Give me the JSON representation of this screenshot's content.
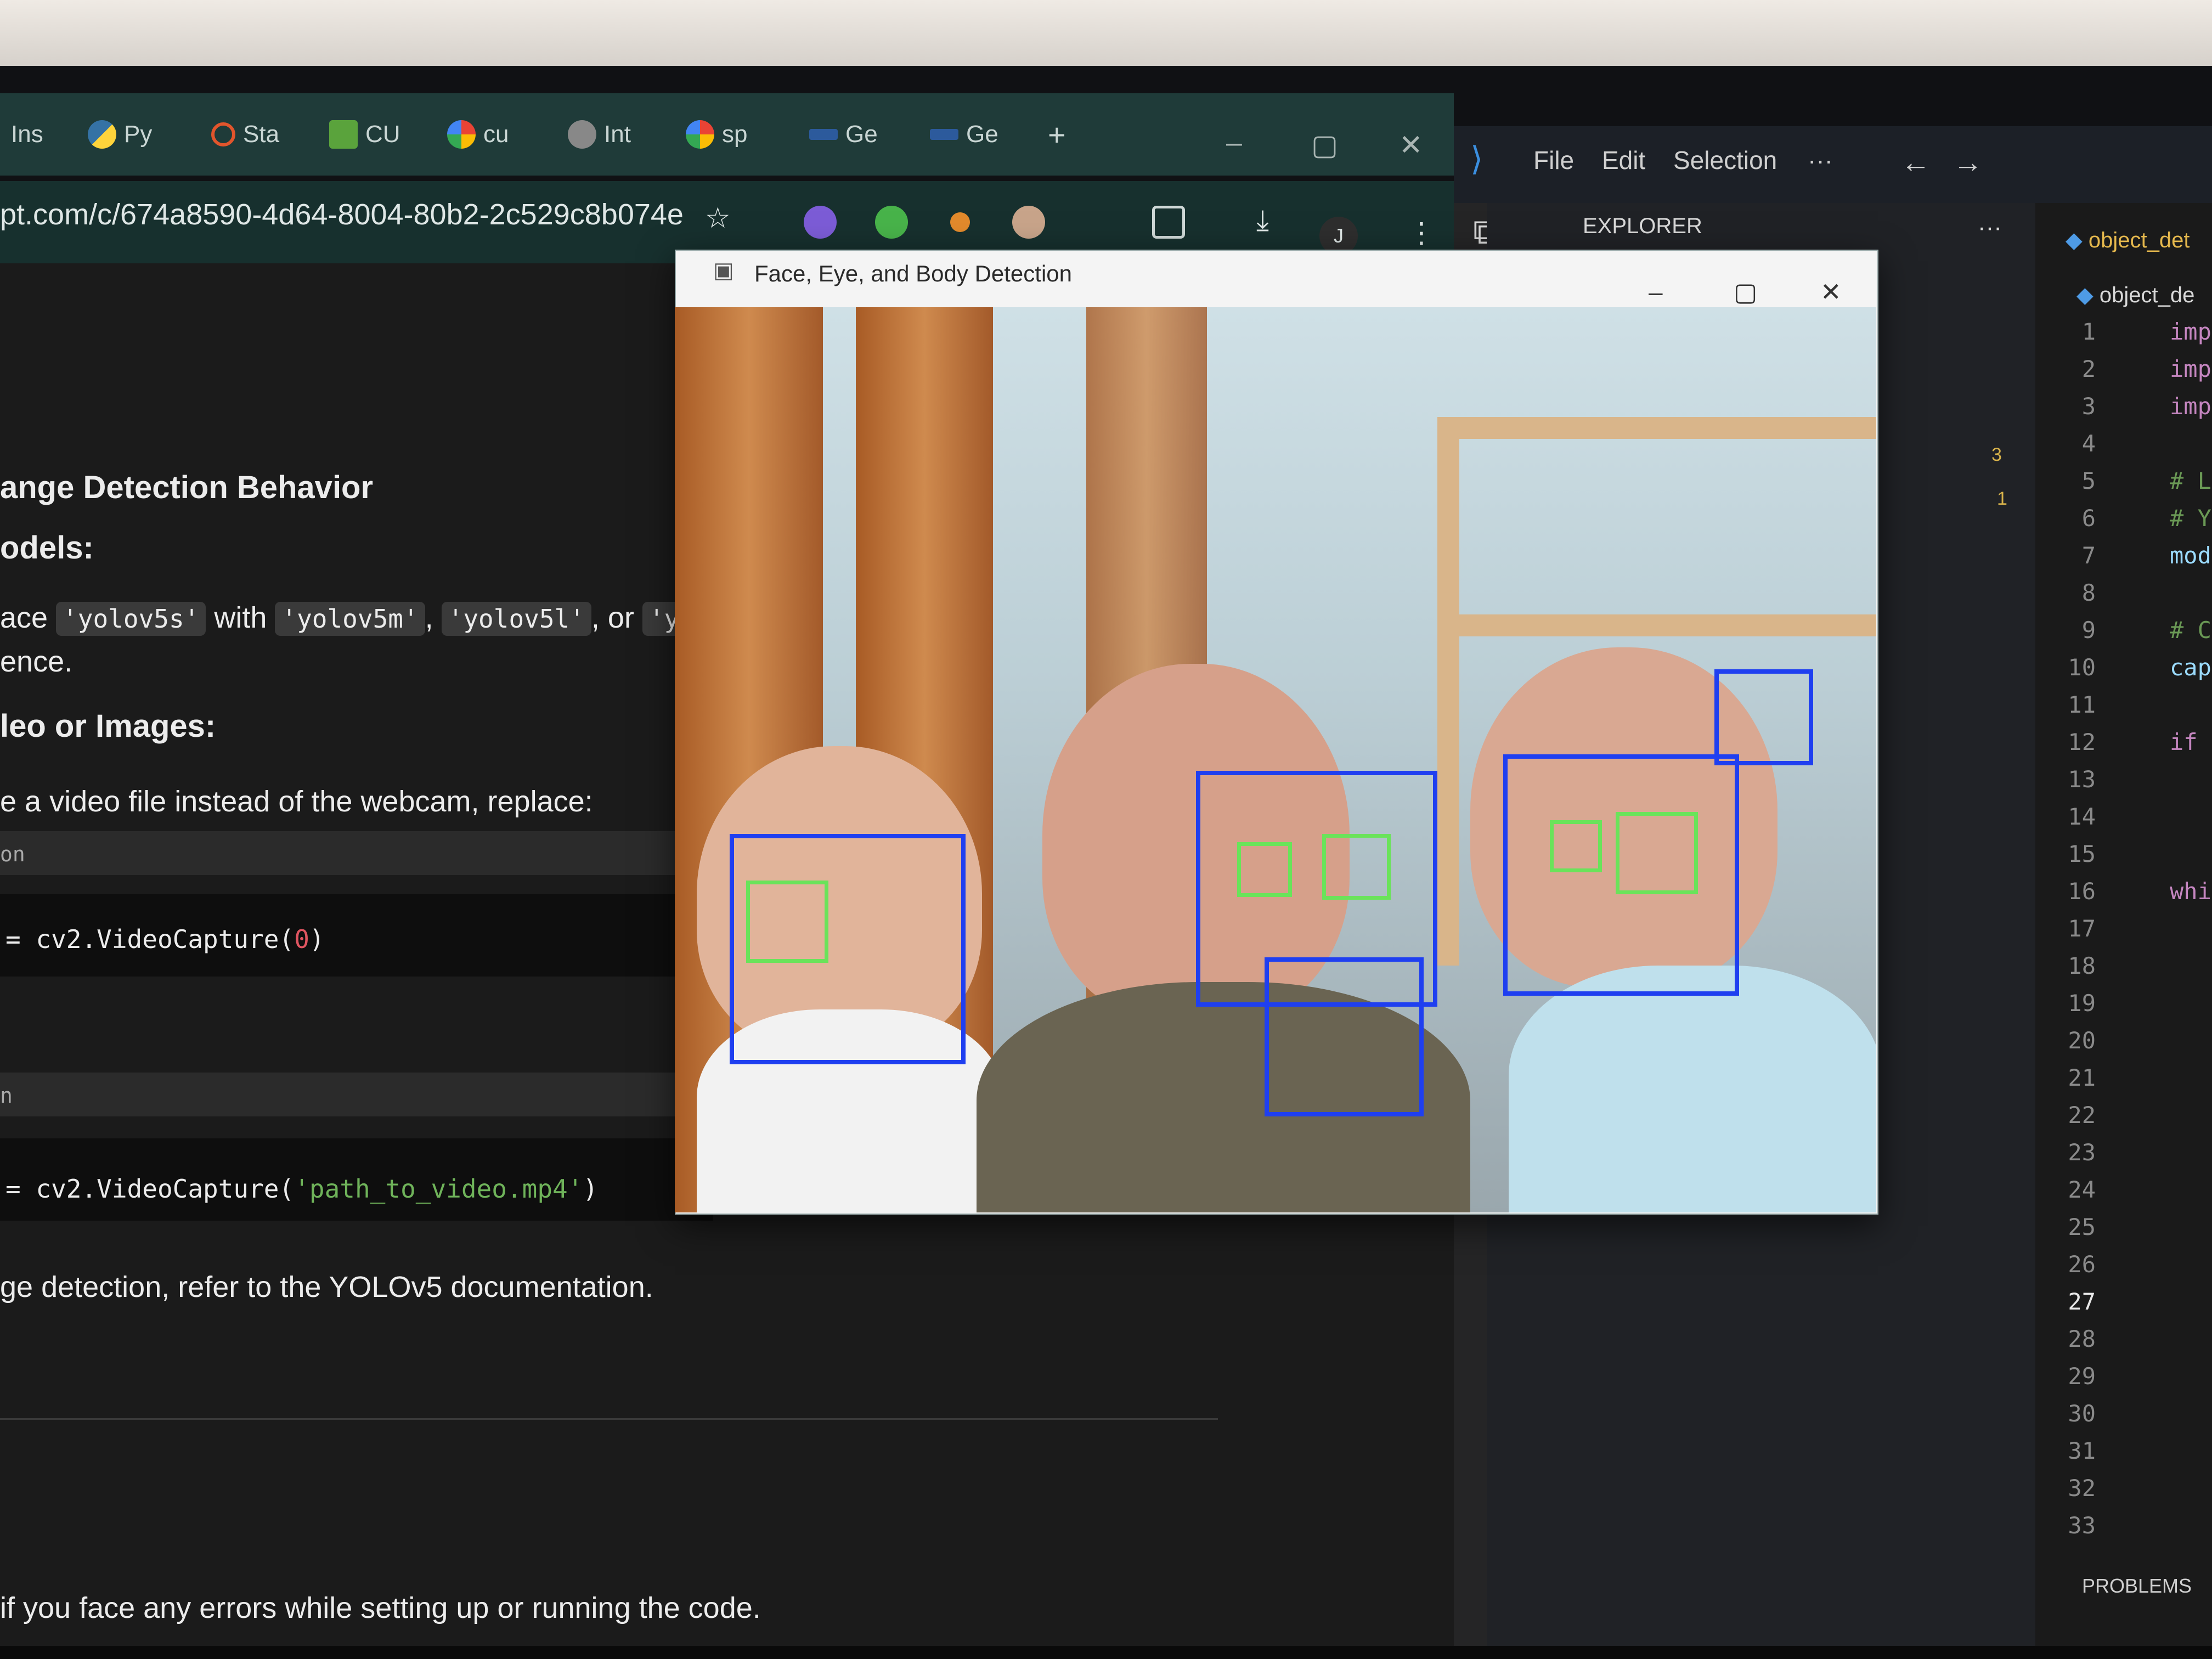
{
  "browser": {
    "tabs": [
      "Ins",
      "Py",
      "Sta",
      "CU",
      "cu",
      "Int",
      "sp",
      "Ge",
      "Ge"
    ],
    "new_tab": "+",
    "url": "pt.com/c/674a8590-4d64-8004-80b2-2c529c8b074e",
    "avatar_letter": "J"
  },
  "chat": {
    "heading_1": "ange Detection Behavior",
    "heading_2": "odels:",
    "para_1_start": "ace",
    "chip_1": "'yolov5s'",
    "para_1_with": "with",
    "chip_2": "'yolov5m'",
    "chip_3": "'yolov5l'",
    "para_1_or": ", or",
    "chip_4": "'y",
    "para_1_end": "ence.",
    "heading_3": "leo or Images:",
    "para_2": "e a video file instead of the webcam, replace:",
    "code_lang_1": "on",
    "code_1": "= cv2.VideoCapture(",
    "code_1_arg": "0",
    "code_1_close": ")",
    "code_lang_2": "n",
    "code_2": "= cv2.VideoCapture(",
    "code_2_arg": "'path_to_video.mp4'",
    "code_2_close": ")",
    "para_3": "ge detection, refer to the YOLOv5 documentation.",
    "para_4": "if you face any errors while setting up or running the code."
  },
  "vscode": {
    "menu": [
      "File",
      "Edit",
      "Selection",
      "···"
    ],
    "explorer_label": "EXPLORER",
    "explorer_more": "···",
    "tab_file": "object_det",
    "breadcrumb_file": "object_de",
    "badge_count": "1",
    "problem_counts": [
      "3",
      "1"
    ],
    "line_numbers": [
      "1",
      "2",
      "3",
      "4",
      "5",
      "6",
      "7",
      "8",
      "9",
      "10",
      "11",
      "12",
      "13",
      "14",
      "15",
      "16",
      "17",
      "18",
      "19",
      "20",
      "21",
      "22",
      "23",
      "24",
      "25",
      "26",
      "27",
      "28",
      "29",
      "30",
      "31",
      "32",
      "33"
    ],
    "active_line": "27",
    "code_tokens": [
      {
        "line": 1,
        "text": "imp",
        "color": "#c586c0"
      },
      {
        "line": 2,
        "text": "imp",
        "color": "#c586c0"
      },
      {
        "line": 3,
        "text": "imp",
        "color": "#c586c0"
      },
      {
        "line": 5,
        "text": "# L",
        "color": "#6a9955"
      },
      {
        "line": 6,
        "text": "# Y",
        "color": "#6a9955"
      },
      {
        "line": 7,
        "text": "mod",
        "color": "#9cdcfe"
      },
      {
        "line": 9,
        "text": "# C",
        "color": "#6a9955"
      },
      {
        "line": 10,
        "text": "cap",
        "color": "#9cdcfe"
      },
      {
        "line": 12,
        "text": "if",
        "color": "#c586c0"
      },
      {
        "line": 16,
        "text": "whi",
        "color": "#c586c0"
      }
    ],
    "panel_tab": "PROBLEMS"
  },
  "detection_window": {
    "title": "Face, Eye, and Body Detection",
    "minimize": "–",
    "maximize": "▢",
    "close": "✕"
  },
  "colors": {
    "face_box": "#1f3ff0",
    "eye_box": "#6ae35a",
    "browser_tabbar": "#1f3b39",
    "editor_bg": "#1e1e1e"
  }
}
